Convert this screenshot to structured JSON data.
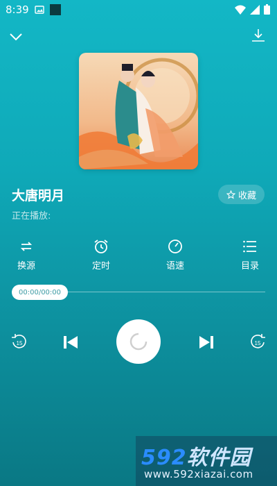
{
  "status_bar": {
    "time": "8:39",
    "left_icons": [
      "image-icon",
      "square-app-icon"
    ],
    "right_icons": [
      "wifi-icon",
      "cellular-icon",
      "battery-icon"
    ]
  },
  "top_bar": {
    "left_icon": "chevron-down-icon",
    "right_icon": "download-icon"
  },
  "track": {
    "title": "大唐明月",
    "status": "正在播放:",
    "favorite_label": "收藏",
    "favorite_icon": "star-outline-icon"
  },
  "actions": [
    {
      "label": "换源",
      "icon": "switch-source-icon"
    },
    {
      "label": "定时",
      "icon": "alarm-clock-icon"
    },
    {
      "label": "语速",
      "icon": "speed-dial-icon"
    },
    {
      "label": "目录",
      "icon": "list-icon"
    }
  ],
  "progress": {
    "time_text": "00:00/00:00",
    "fraction": 0
  },
  "controls": {
    "rewind_label": "15",
    "forward_label": "15"
  },
  "watermark": {
    "logo_digits": "592",
    "logo_text": "软件园",
    "url": "www.592xiazai.com"
  },
  "colors": {
    "background_top": "#13b7c6",
    "background_bottom": "#0a7884",
    "accent": "#ffffff"
  }
}
